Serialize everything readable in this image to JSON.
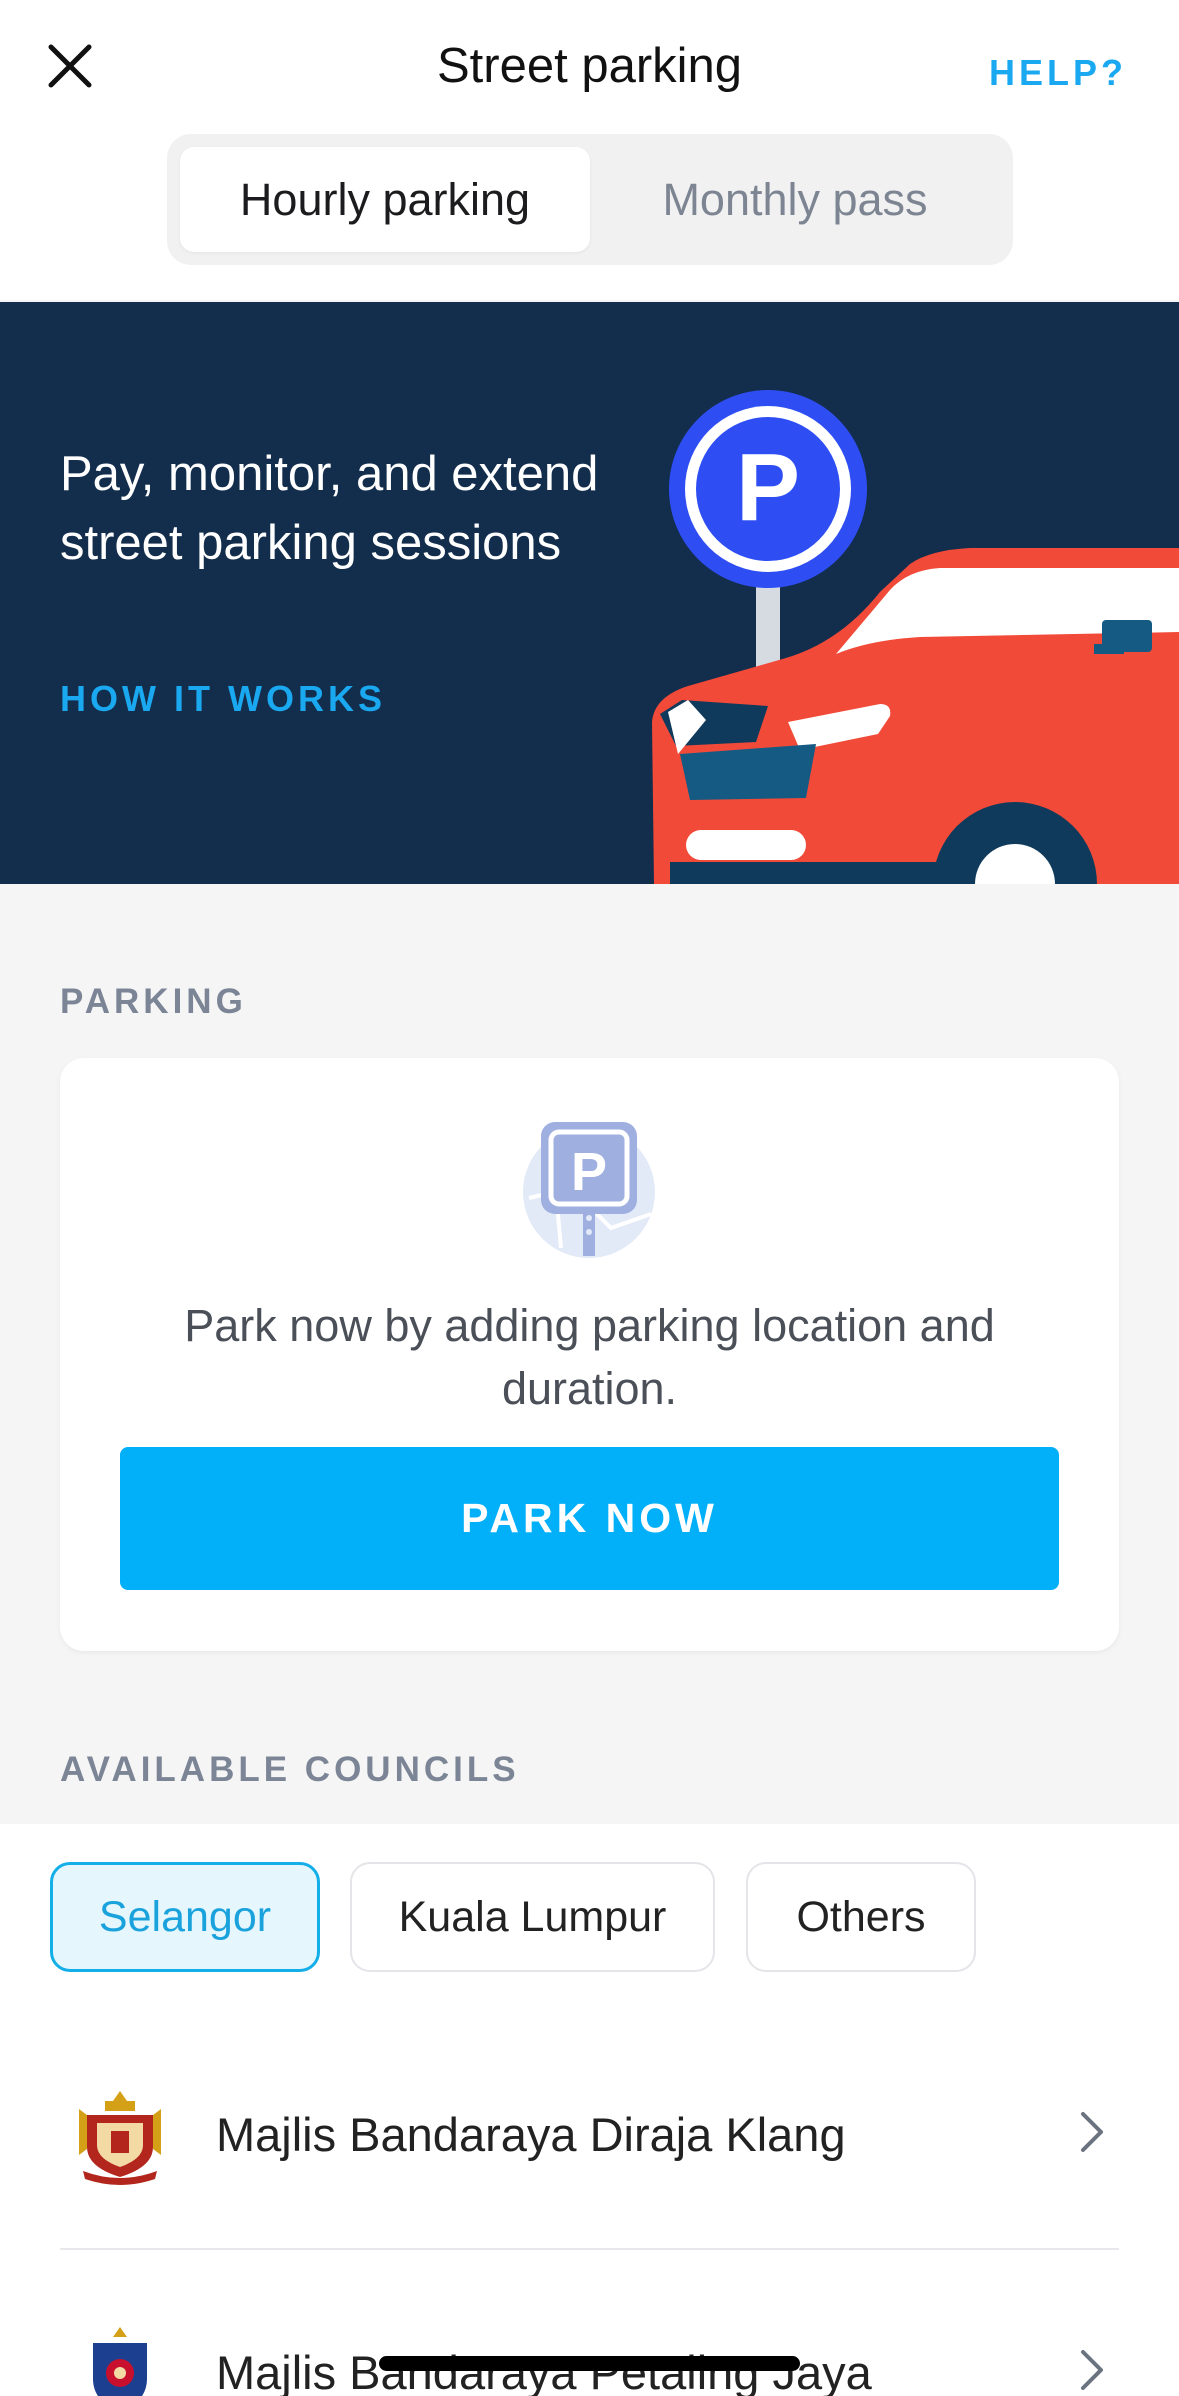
{
  "header": {
    "title": "Street parking",
    "help_label": "HELP?"
  },
  "tabs": [
    {
      "label": "Hourly parking",
      "active": true
    },
    {
      "label": "Monthly pass",
      "active": false
    }
  ],
  "banner": {
    "text": "Pay, monitor, and extend street parking sessions",
    "link_label": "HOW IT WORKS"
  },
  "parking": {
    "section_label": "PARKING",
    "message": "Park now by adding parking location and duration.",
    "button_label": "PARK NOW"
  },
  "councils": {
    "section_label": "AVAILABLE COUNCILS",
    "filters": [
      {
        "label": "Selangor",
        "selected": true
      },
      {
        "label": "Kuala Lumpur",
        "selected": false
      },
      {
        "label": "Others",
        "selected": false
      }
    ],
    "items": [
      {
        "name": "Majlis Bandaraya Diraja Klang",
        "icon": "klang-crest-icon"
      },
      {
        "name": "Majlis Bandaraya Petaling Jaya",
        "icon": "petaling-jaya-crest-icon"
      }
    ]
  },
  "colors": {
    "accent": "#02aff9",
    "link": "#1aa8f0",
    "banner_bg": "#132d4c",
    "car": "#f24a38"
  }
}
